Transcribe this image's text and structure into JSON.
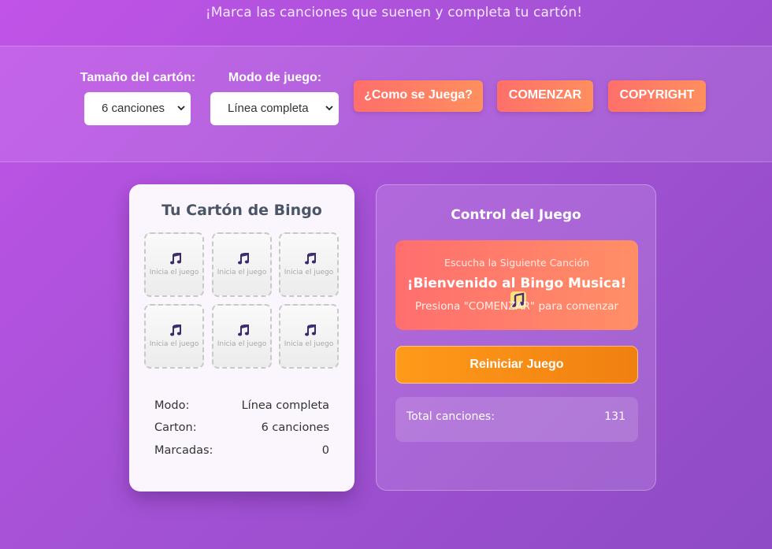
{
  "header": {
    "subtitle": "¡Marca las canciones que suenen y completa tu cartón!"
  },
  "controls": {
    "size_label": "Tamaño del cartón:",
    "size_value": "6 canciones",
    "mode_label": "Modo de juego:",
    "mode_value": "Línea completa",
    "how_to_play": "¿Como se Juega?",
    "start": "COMENZAR",
    "copyright": "COPYRIGHT"
  },
  "bingo_card": {
    "title": "Tu Cartón de Bingo",
    "cells": [
      {
        "icon": "music-note-icon",
        "caption": "Inicia el juego"
      },
      {
        "icon": "music-note-icon",
        "caption": "Inicia el juego"
      },
      {
        "icon": "music-note-icon",
        "caption": "Inicia el juego"
      },
      {
        "icon": "music-note-icon",
        "caption": "Inicia el juego"
      },
      {
        "icon": "music-note-icon",
        "caption": "Inicia el juego"
      },
      {
        "icon": "music-note-icon",
        "caption": "Inicia el juego"
      }
    ],
    "stats": [
      {
        "label": "Modo:",
        "value": "Línea completa"
      },
      {
        "label": "Carton:",
        "value": "6 canciones"
      },
      {
        "label": "Marcadas:",
        "value": "0"
      }
    ]
  },
  "game_control": {
    "title": "Control del Juego",
    "now_playing_label": "Escucha la Siguiente Canción",
    "now_playing_title": "¡Bienvenido al Bingo Musica!",
    "now_playing_hint": "Presiona \"COMENZAR\" para comenzar",
    "restart": "Reiniciar Juego",
    "total_label": "Total canciones:",
    "total_value": "131"
  },
  "colors": {
    "accent_button": "#ff7a66",
    "restart_button": "#f88a12",
    "background": "#a552d6"
  }
}
